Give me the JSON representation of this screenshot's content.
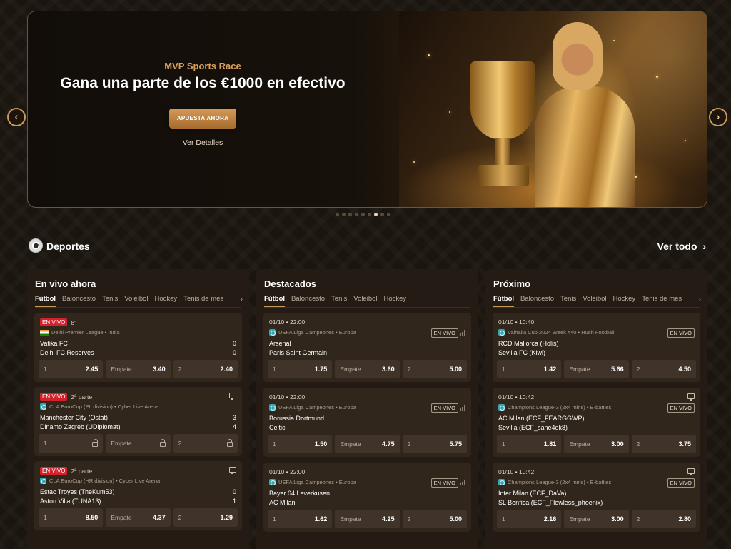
{
  "banner": {
    "kicker": "MVP Sports Race",
    "title": "Gana una parte de los €1000 en efectivo",
    "cta": "APUESTA AHORA",
    "details_link": "Ver Detalles",
    "prev_icon": "chevron-left-icon",
    "next_icon": "chevron-right-icon",
    "slide_count": 9,
    "active_slide": 6
  },
  "sports": {
    "title": "Deportes",
    "see_all": "Ver todo"
  },
  "columns": [
    {
      "title": "En vivo ahora",
      "tabs": [
        "Fútbol",
        "Baloncesto",
        "Tenis",
        "Voleibol",
        "Hockey",
        "Tenis de mesa"
      ],
      "cards": [
        {
          "live": "EN VIVO",
          "time": "8'",
          "league": "Delhi Premier League • India",
          "league_icon": "flag-india-icon",
          "team1": "Vatika FC",
          "team2": "Delhi FC Reserves",
          "score1": "0",
          "score2": "0",
          "odds": [
            {
              "label": "1",
              "value": "2.45"
            },
            {
              "label": "Empate",
              "value": "3.40"
            },
            {
              "label": "2",
              "value": "2.40"
            }
          ],
          "tv": false,
          "locked": false
        },
        {
          "live": "EN VIVO",
          "time": "2ª parte",
          "league": "CLA EuroCup (PL division) • Cyber Live Arena",
          "league_icon": "globe-icon",
          "team1": "Manchester City (Ostat)",
          "team2": "Dinamo Zagreb (UDiplomat)",
          "score1": "3",
          "score2": "4",
          "odds": [
            {
              "label": "1",
              "value": ""
            },
            {
              "label": "Empate",
              "value": ""
            },
            {
              "label": "2",
              "value": ""
            }
          ],
          "tv": true,
          "locked": true
        },
        {
          "live": "EN VIVO",
          "time": "2ª parte",
          "league": "CLA EuroCup (HR division) • Cyber Live Arena",
          "league_icon": "globe-icon",
          "team1": "Estac Troyes (TheKum53)",
          "team2": "Aston Villa (TUNA13)",
          "score1": "0",
          "score2": "1",
          "odds": [
            {
              "label": "1",
              "value": "8.50"
            },
            {
              "label": "Empate",
              "value": "4.37"
            },
            {
              "label": "2",
              "value": "1.29"
            }
          ],
          "tv": true,
          "locked": false
        }
      ]
    },
    {
      "title": "Destacados",
      "tabs": [
        "Fútbol",
        "Baloncesto",
        "Tenis",
        "Voleibol",
        "Hockey"
      ],
      "cards": [
        {
          "datetime": "01/10 • 22:00",
          "league": "UEFA Liga Campeones • Europa",
          "league_icon": "globe-icon",
          "status": "EN VIVO",
          "team1": "Arsenal",
          "team2": "París Saint Germain",
          "odds": [
            {
              "label": "1",
              "value": "1.75"
            },
            {
              "label": "Empate",
              "value": "3.60"
            },
            {
              "label": "2",
              "value": "5.00"
            }
          ]
        },
        {
          "datetime": "01/10 • 22:00",
          "league": "UEFA Liga Campeones • Europa",
          "league_icon": "globe-icon",
          "status": "EN VIVO",
          "team1": "Borussia Dortmund",
          "team2": "Celtic",
          "odds": [
            {
              "label": "1",
              "value": "1.50"
            },
            {
              "label": "Empate",
              "value": "4.75"
            },
            {
              "label": "2",
              "value": "5.75"
            }
          ]
        },
        {
          "datetime": "01/10 • 22:00",
          "league": "UEFA Liga Campeones • Europa",
          "league_icon": "globe-icon",
          "status": "EN VIVO",
          "team1": "Bayer 04 Leverkusen",
          "team2": "AC Milan",
          "odds": [
            {
              "label": "1",
              "value": "1.62"
            },
            {
              "label": "Empate",
              "value": "4.25"
            },
            {
              "label": "2",
              "value": "5.00"
            }
          ]
        }
      ]
    },
    {
      "title": "Próximo",
      "tabs": [
        "Fútbol",
        "Baloncesto",
        "Tenis",
        "Voleibol",
        "Hockey",
        "Tenis de mesa"
      ],
      "cards": [
        {
          "datetime": "01/10 • 10:40",
          "league": "Valhalla Cup 2024 Week #40 • Rush Football",
          "league_icon": "globe-icon",
          "status": "EN VIVO",
          "team1": "RCD Mallorca (Holis)",
          "team2": "Sevilla FC (Kiwi)",
          "odds": [
            {
              "label": "1",
              "value": "1.42"
            },
            {
              "label": "Empate",
              "value": "5.66"
            },
            {
              "label": "2",
              "value": "4.50"
            }
          ],
          "tv": false
        },
        {
          "datetime": "01/10 • 10:42",
          "league": "Champions League-3 (2x4 mins) • E-battles",
          "league_icon": "globe-icon",
          "status": "EN VIVO",
          "team1": "AC Milan (ECF_FEARGGWP)",
          "team2": "Sevilla (ECF_sane4ek8)",
          "odds": [
            {
              "label": "1",
              "value": "1.81"
            },
            {
              "label": "Empate",
              "value": "3.00"
            },
            {
              "label": "2",
              "value": "3.75"
            }
          ],
          "tv": true
        },
        {
          "datetime": "01/10 • 10:42",
          "league": "Champions League-3 (2x4 mins) • E-battles",
          "league_icon": "globe-icon",
          "status": "EN VIVO",
          "team1": "Inter Milan (ECF_DaVa)",
          "team2": "SL Benfica (ECF_Flewless_phoenix)",
          "odds": [
            {
              "label": "1",
              "value": "2.16"
            },
            {
              "label": "Empate",
              "value": "3.00"
            },
            {
              "label": "2",
              "value": "2.80"
            }
          ],
          "tv": true
        }
      ]
    }
  ]
}
